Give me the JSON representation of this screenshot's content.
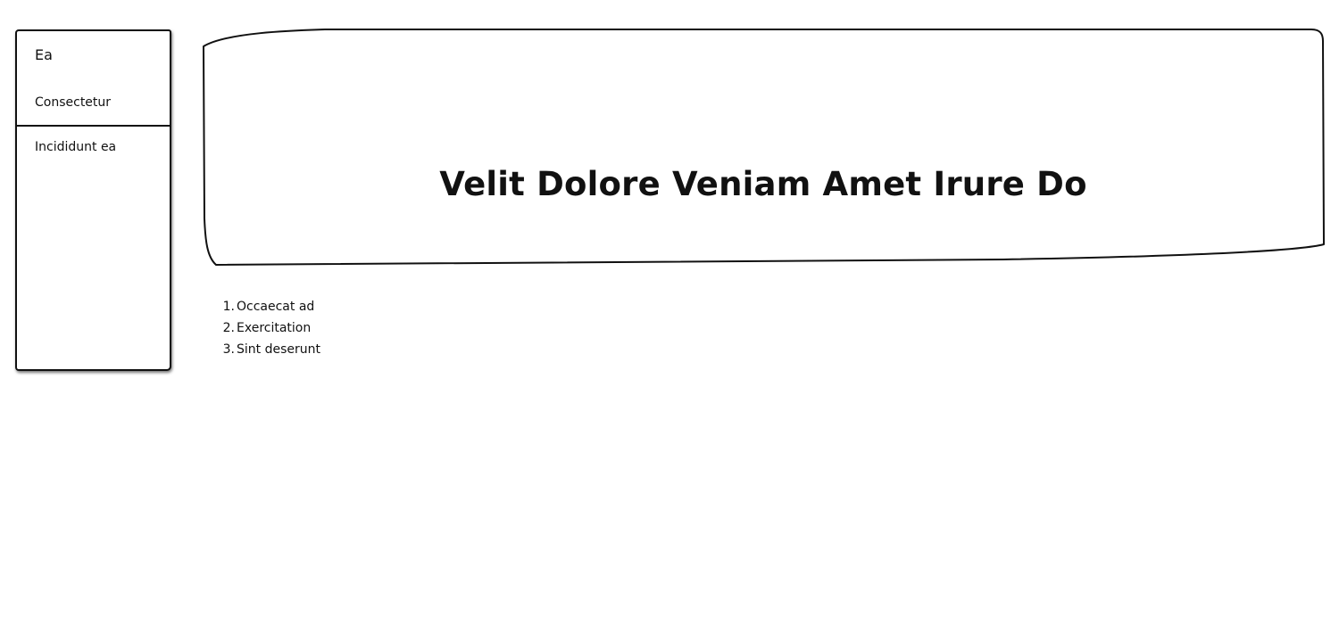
{
  "sidebar": {
    "heading": "Ea",
    "links": [
      {
        "label": "Consectetur"
      },
      {
        "label": "Incididunt ea"
      }
    ]
  },
  "hero": {
    "title": "Velit Dolore Veniam Amet Irure Do"
  },
  "list": {
    "items": [
      {
        "number": "1.",
        "label": "Occaecat ad"
      },
      {
        "number": "2.",
        "label": "Exercitation"
      },
      {
        "number": "3.",
        "label": "Sint deserunt"
      }
    ]
  }
}
